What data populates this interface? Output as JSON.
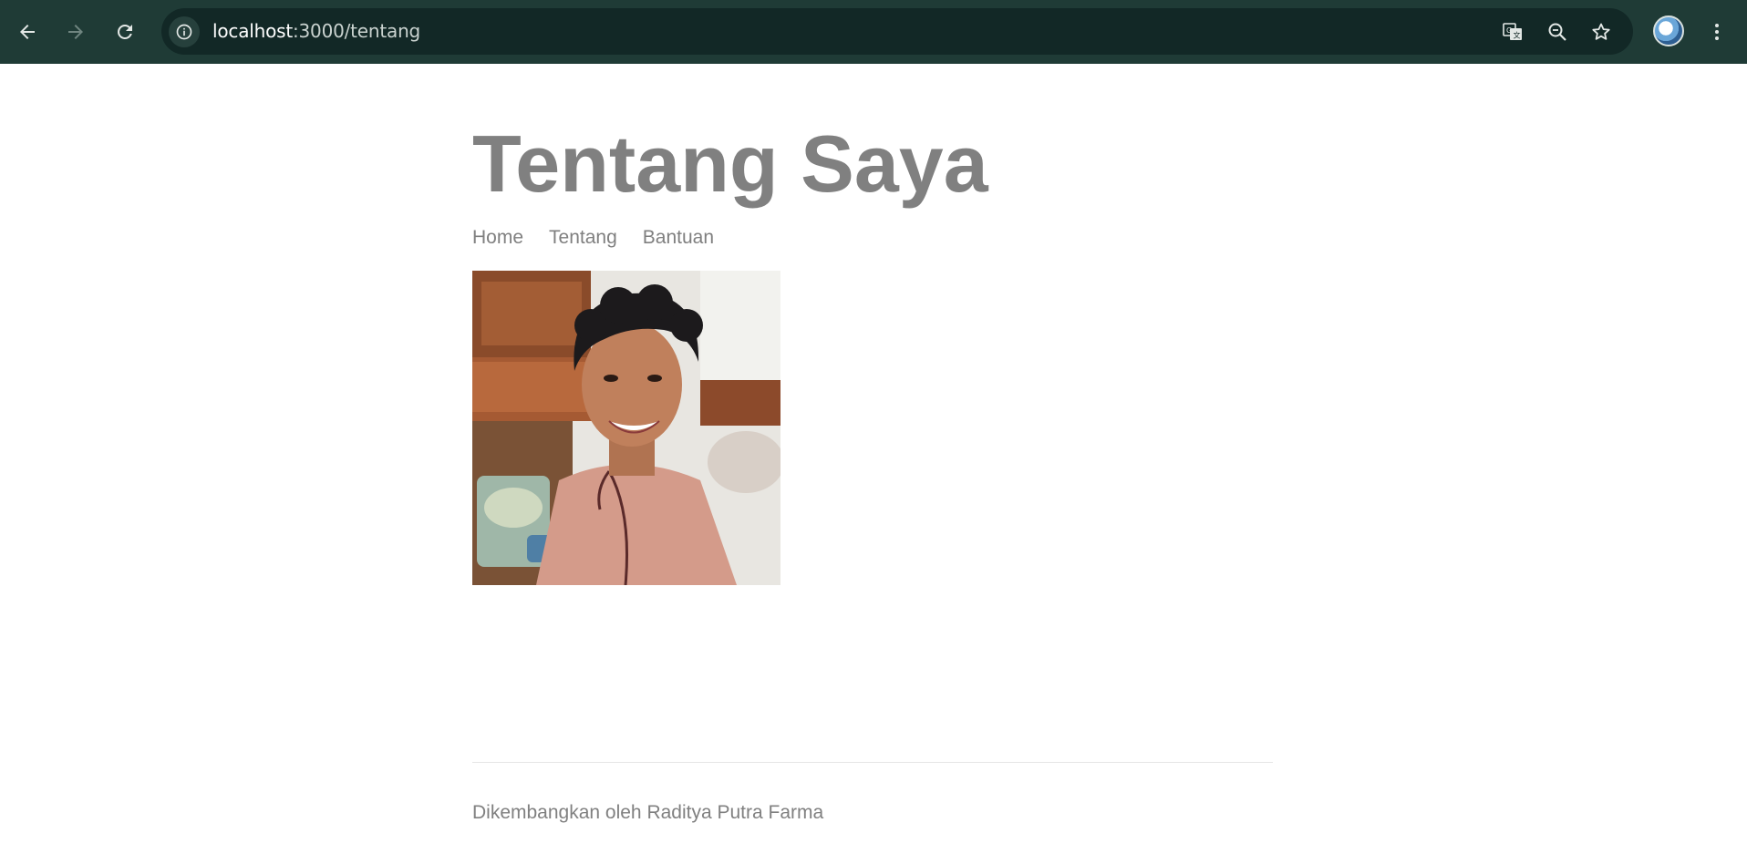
{
  "browser": {
    "url_host": "localhost",
    "url_path": ":3000/tentang",
    "icons": {
      "back": "arrow-left-icon",
      "forward": "arrow-right-icon",
      "reload": "reload-icon",
      "site_info": "info-icon",
      "translate": "translate-icon",
      "zoom": "zoom-out-icon",
      "bookmark": "star-icon",
      "menu": "kebab-menu-icon"
    },
    "colors": {
      "toolbar": "#1f3b36",
      "omnibox": "#122826"
    }
  },
  "page": {
    "title": "Tentang Saya",
    "nav": [
      {
        "label": "Home"
      },
      {
        "label": "Tentang"
      },
      {
        "label": "Bantuan"
      }
    ],
    "footer": "Dikembangkan oleh Raditya Putra Farma",
    "colors": {
      "text": "#808080",
      "background": "#ffffff"
    }
  }
}
